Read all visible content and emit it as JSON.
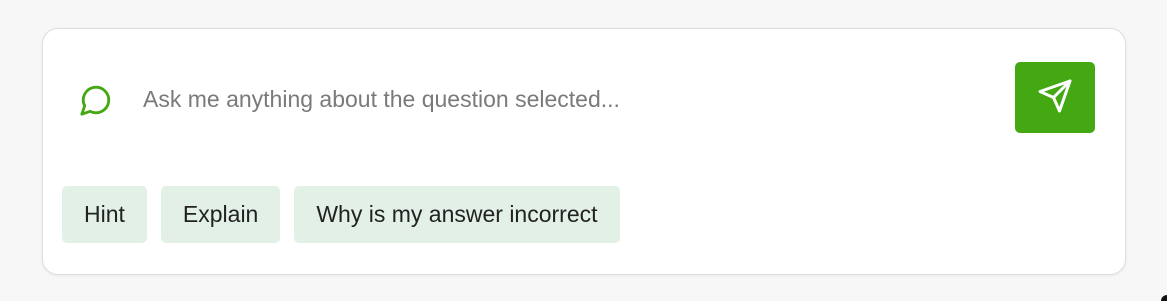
{
  "chat": {
    "placeholder": "Ask me anything about the question selected...",
    "value": "",
    "icon": "chat-bubble-icon",
    "send_icon": "send-icon"
  },
  "suggestions": [
    {
      "label": "Hint"
    },
    {
      "label": "Explain"
    },
    {
      "label": "Why is my answer incorrect"
    }
  ],
  "colors": {
    "accent": "#43a812",
    "chip_background": "#e2f0e6"
  }
}
